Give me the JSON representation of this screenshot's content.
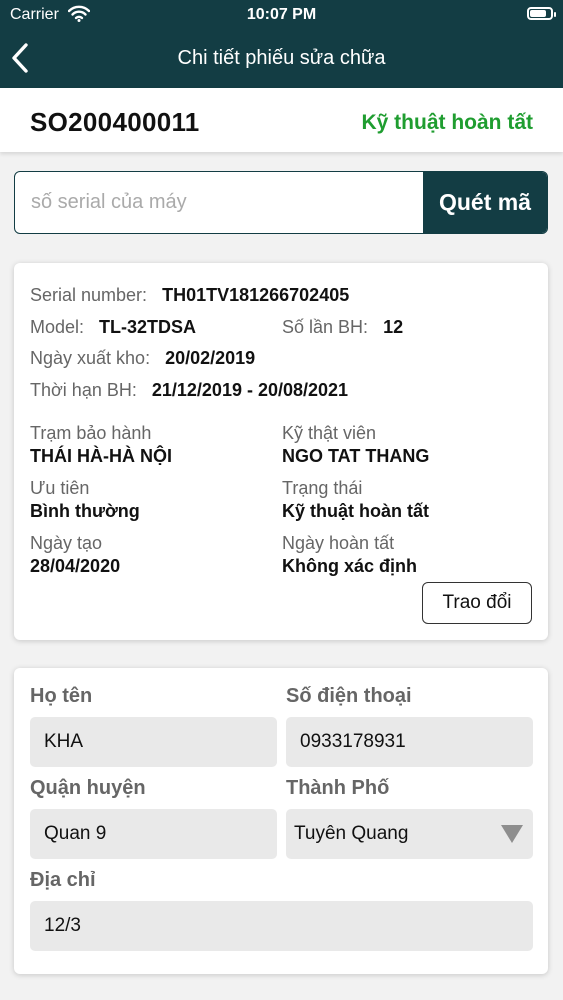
{
  "status_bar": {
    "carrier": "Carrier",
    "time": "10:07 PM",
    "battery_level": 0.9
  },
  "nav": {
    "title": "Chi tiết phiếu sửa chữa",
    "back_icon": "chevron-left-icon"
  },
  "ticket": {
    "code": "SO200400011",
    "status": "Kỹ thuật hoàn tất",
    "status_color": "#1f9d30"
  },
  "scan": {
    "placeholder": "số serial của máy",
    "value": "",
    "button_label": "Quét mã"
  },
  "info": {
    "serial_label": "Serial number:",
    "serial_value": "TH01TV181266702405",
    "model_label": "Model:",
    "model_value": "TL-32TDSA",
    "warranty_count_label": "Số lần BH:",
    "warranty_count_value": "12",
    "export_date_label": "Ngày xuất kho:",
    "export_date_value": "20/02/2019",
    "warranty_period_label": "Thời hạn BH:",
    "warranty_period_value": "21/12/2019 - 20/08/2021",
    "station_label": "Trạm bảo hành",
    "station_value": "THÁI HÀ-HÀ NỘI",
    "technician_label": "Kỹ thật viên",
    "technician_value": "NGO TAT THANG",
    "priority_label": "Ưu tiên",
    "priority_value": "Bình thường",
    "state_label": "Trạng thái",
    "state_value": "Kỹ thuật hoàn tất",
    "created_label": "Ngày tạo",
    "created_value": "28/04/2020",
    "completed_label": "Ngày hoàn tất",
    "completed_value": "Không xác định",
    "exchange_button": "Trao đổi"
  },
  "customer": {
    "name_label": "Họ tên",
    "name_value": "KHA",
    "phone_label": "Số điện thoại",
    "phone_value": "0933178931",
    "district_label": "Quận huyện",
    "district_value": "Quan 9",
    "city_label": "Thành Phố",
    "city_value": "Tuyên Quang",
    "address_label": "Địa chỉ",
    "address_value": "12/3"
  },
  "colors": {
    "header_bg": "#133d44",
    "accent": "#133d44",
    "status_green": "#1f9d30",
    "field_bg": "#e9e9e9"
  }
}
